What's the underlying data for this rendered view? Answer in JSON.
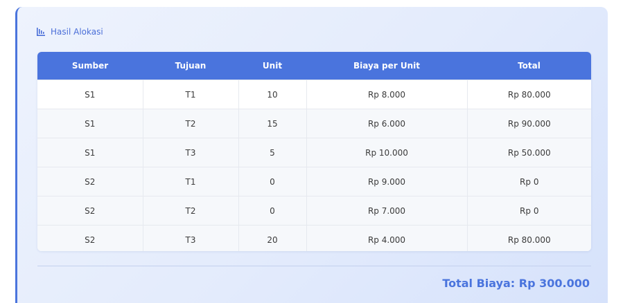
{
  "panel": {
    "title": "Hasil Alokasi",
    "icon": "bar-chart-icon",
    "accent_color": "#4a74dd"
  },
  "table": {
    "headers": [
      "Sumber",
      "Tujuan",
      "Unit",
      "Biaya per Unit",
      "Total"
    ],
    "rows": [
      [
        "S1",
        "T1",
        "10",
        "Rp 8.000",
        "Rp 80.000"
      ],
      [
        "S1",
        "T2",
        "15",
        "Rp 6.000",
        "Rp 90.000"
      ],
      [
        "S1",
        "T3",
        "5",
        "Rp 10.000",
        "Rp 50.000"
      ],
      [
        "S2",
        "T1",
        "0",
        "Rp 9.000",
        "Rp 0"
      ],
      [
        "S2",
        "T2",
        "0",
        "Rp 7.000",
        "Rp 0"
      ],
      [
        "S2",
        "T3",
        "20",
        "Rp 4.000",
        "Rp 80.000"
      ]
    ]
  },
  "summary": {
    "total_label": "Total Biaya: Rp 300.000"
  }
}
